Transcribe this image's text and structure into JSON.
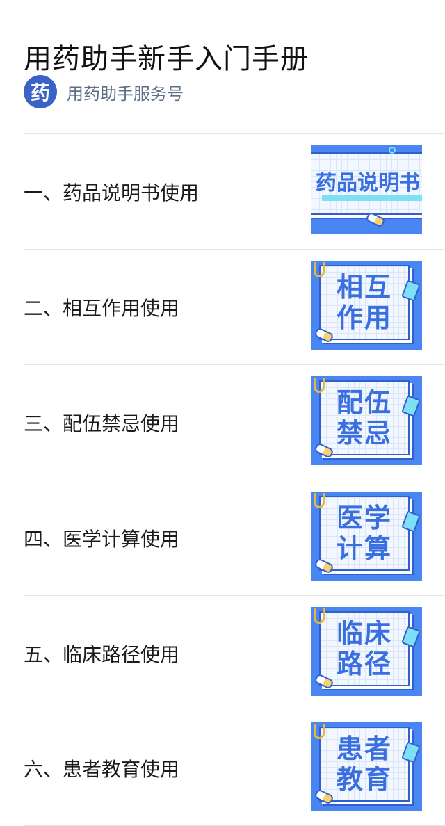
{
  "article": {
    "title": "用药助手新手入门手册",
    "account": {
      "avatar_char": "药",
      "name": "用药助手服务号"
    }
  },
  "items": [
    {
      "title": "一、药品说明书使用",
      "thumb_text": "药品说明书"
    },
    {
      "title": "二、相互作用使用",
      "thumb_line1": "相互",
      "thumb_line2": "作用"
    },
    {
      "title": "三、配伍禁忌使用",
      "thumb_line1": "配伍",
      "thumb_line2": "禁忌"
    },
    {
      "title": "四、医学计算使用",
      "thumb_line1": "医学",
      "thumb_line2": "计算"
    },
    {
      "title": "五、临床路径使用",
      "thumb_line1": "临床",
      "thumb_line2": "路径"
    },
    {
      "title": "六、患者教育使用",
      "thumb_line1": "患者",
      "thumb_line2": "教育"
    }
  ],
  "colors": {
    "thumb_background": "#4a86f2",
    "thumb_text": "#3a6fe0",
    "avatar": "#3a63c8",
    "account_name": "#5d6f88"
  }
}
